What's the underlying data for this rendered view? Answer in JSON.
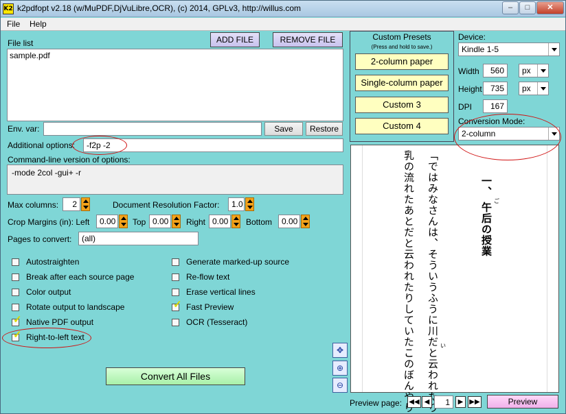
{
  "window": {
    "title": "k2pdfopt v2.18 (w/MuPDF,DjVuLibre,OCR), (c) 2014, GPLv3, http://willus.com",
    "icon_text": "K2"
  },
  "menu": {
    "file": "File",
    "help": "Help"
  },
  "filelist": {
    "label": "File list",
    "add": "ADD FILE",
    "remove": "REMOVE FILE",
    "items": [
      "sample.pdf"
    ]
  },
  "env": {
    "label": "Env. var:",
    "value": "",
    "save": "Save",
    "restore": "Restore"
  },
  "additional": {
    "label": "Additional options:",
    "value": "-f2p -2"
  },
  "cmdline": {
    "label": "Command-line version of options:",
    "value": "-mode 2col -gui+ -r"
  },
  "params": {
    "max_columns_label": "Max columns:",
    "max_columns": "2",
    "doc_res_label": "Document Resolution Factor:",
    "doc_res": "1.0",
    "crop_label": "Crop Margins (in): Left",
    "left": "0.00",
    "top_label": "Top",
    "top": "0.00",
    "right_label": "Right",
    "right": "0.00",
    "bottom_label": "Bottom",
    "bottom": "0.00",
    "pages_label": "Pages to convert:",
    "pages": "(all)"
  },
  "options_left": [
    {
      "label": "Autostraighten",
      "checked": false
    },
    {
      "label": "Break after each source page",
      "checked": false
    },
    {
      "label": "Color output",
      "checked": false
    },
    {
      "label": "Rotate output to landscape",
      "checked": false
    },
    {
      "label": "Native PDF output",
      "checked": true
    },
    {
      "label": "Right-to-left text",
      "checked": true
    }
  ],
  "options_right": [
    {
      "label": "Generate marked-up source",
      "checked": false
    },
    {
      "label": "Re-flow text",
      "checked": false
    },
    {
      "label": "Erase vertical lines",
      "checked": false
    },
    {
      "label": "Fast Preview",
      "checked": true
    },
    {
      "label": "OCR (Tesseract)",
      "checked": false
    }
  ],
  "convert": "Convert All Files",
  "presets": {
    "title": "Custom Presets",
    "subtitle": "(Press and hold to save.)",
    "p1": "2-column paper",
    "p2": "Single-column paper",
    "p3": "Custom 3",
    "p4": "Custom 4"
  },
  "device": {
    "label": "Device:",
    "value": "Kindle 1-5",
    "width_label": "Width",
    "width": "560",
    "width_unit": "px",
    "height_label": "Height",
    "height": "735",
    "height_unit": "px",
    "dpi_label": "DPI",
    "dpi": "167",
    "mode_label": "Conversion Mode:",
    "mode": "2-column"
  },
  "preview": {
    "col1": "一、 午后の授業",
    "col2": "「ではみなさんは、そういうふうに川だと云われたり、",
    "col3": "乳の流れたあとだと云われたりしていたこのぼんやり",
    "ruby1": "ご",
    "ruby2": "い",
    "page_label": "Preview page:",
    "page": "1",
    "button": "Preview"
  },
  "colors": {
    "bg": "#7fd6d6",
    "annotation": "#d01010",
    "check": "#d8d800"
  }
}
